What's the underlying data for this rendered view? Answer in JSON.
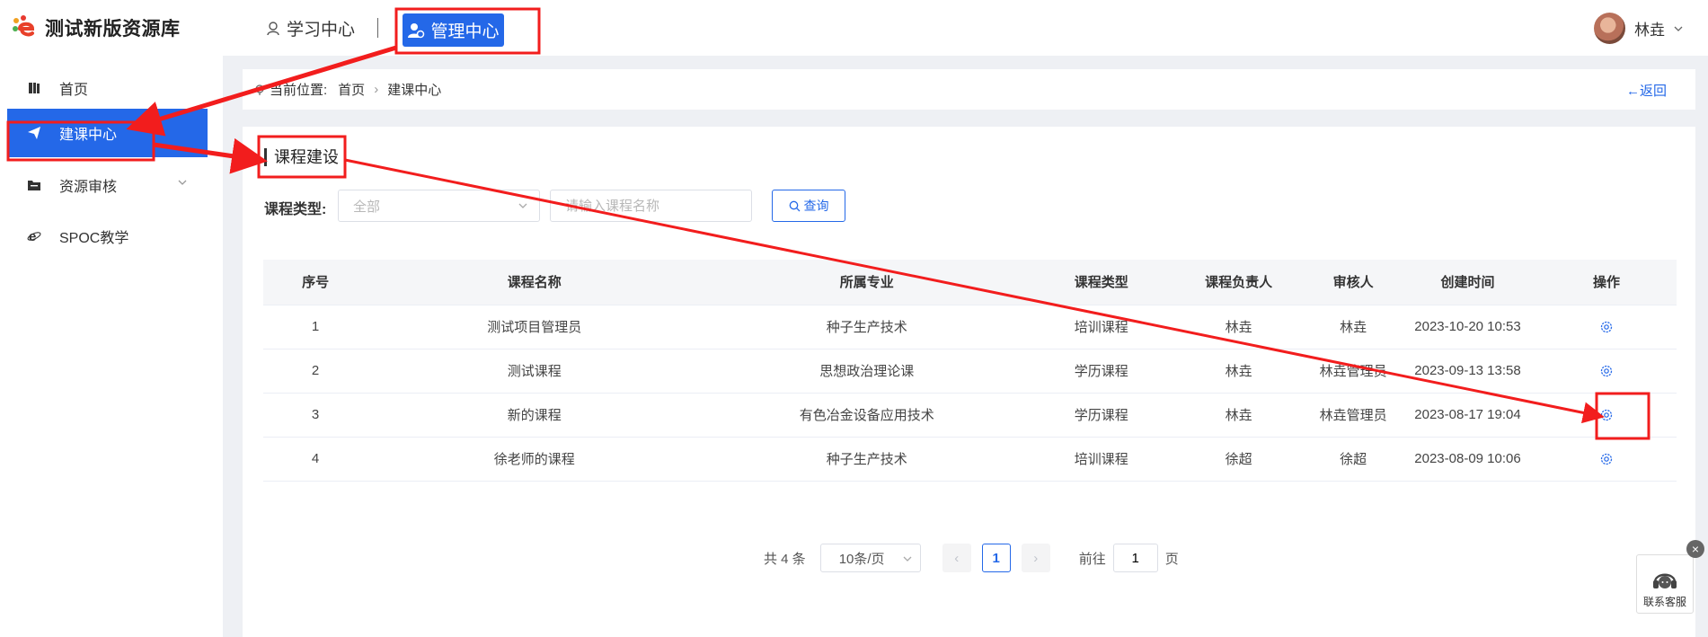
{
  "header": {
    "logo_text": "测试新版资源库",
    "nav_study": "学习中心",
    "nav_manage": "管理中心",
    "user_name": "林垚"
  },
  "sidebar": {
    "items": [
      {
        "label": "首页",
        "icon": "book-icon"
      },
      {
        "label": "建课中心",
        "icon": "send-icon"
      },
      {
        "label": "资源审核",
        "icon": "folder-icon"
      },
      {
        "label": "SPOC教学",
        "icon": "ie-icon"
      }
    ]
  },
  "breadcrumb": {
    "prefix": "当前位置:",
    "home": "首页",
    "current": "建课中心",
    "back": "←返回"
  },
  "section": {
    "title": "课程建设"
  },
  "filter": {
    "type_label": "课程类型:",
    "type_value": "全部",
    "name_placeholder": "请输入课程名称",
    "query_label": "查询"
  },
  "table": {
    "headers": [
      "序号",
      "课程名称",
      "所属专业",
      "课程类型",
      "课程负责人",
      "审核人",
      "创建时间",
      "操作"
    ],
    "rows": [
      [
        "1",
        "测试项目管理员",
        "种子生产技术",
        "培训课程",
        "林垚",
        "林垚",
        "2023-10-20 10:53"
      ],
      [
        "2",
        "测试课程",
        "思想政治理论课",
        "学历课程",
        "林垚",
        "林垚管理员",
        "2023-09-13 13:58"
      ],
      [
        "3",
        "新的课程",
        "有色冶金设备应用技术",
        "学历课程",
        "林垚",
        "林垚管理员",
        "2023-08-17 19:04"
      ],
      [
        "4",
        "徐老师的课程",
        "种子生产技术",
        "培训课程",
        "徐超",
        "徐超",
        "2023-08-09 10:06"
      ]
    ]
  },
  "pagination": {
    "total": "共 4 条",
    "page_size": "10条/页",
    "current_page": "1",
    "goto_label": "前往",
    "goto_value": "1",
    "page_suffix": "页"
  },
  "service": {
    "label": "联系客服"
  },
  "colors": {
    "accent": "#2468e8",
    "annotation": "#f21d1d"
  }
}
